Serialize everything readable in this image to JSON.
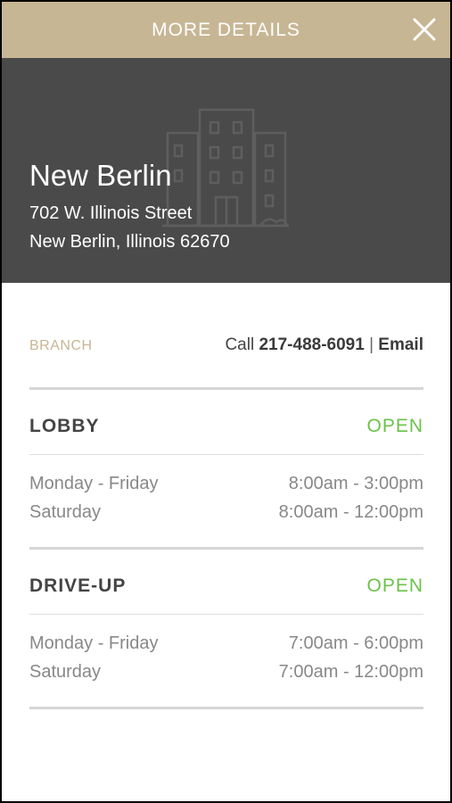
{
  "header": {
    "title": "MORE DETAILS",
    "close_icon": "close-icon"
  },
  "hero": {
    "branch_name": "New Berlin",
    "address_line1": "702 W. Illinois Street",
    "address_line2": "New Berlin, Illinois 62670",
    "illustration_icon": "building-icon",
    "background_color": "#4a4a4a"
  },
  "contact": {
    "label": "BRANCH",
    "call_prefix": "Call",
    "phone": "217-488-6091",
    "separator": "|",
    "email_label": "Email"
  },
  "sections": [
    {
      "title": "LOBBY",
      "status": "OPEN",
      "hours": [
        {
          "days": "Monday - Friday",
          "time": "8:00am - 3:00pm"
        },
        {
          "days": "Saturday",
          "time": "8:00am - 12:00pm"
        }
      ]
    },
    {
      "title": "DRIVE-UP",
      "status": "OPEN",
      "hours": [
        {
          "days": "Monday - Friday",
          "time": "7:00am - 6:00pm"
        },
        {
          "days": "Saturday",
          "time": "7:00am - 12:00pm"
        }
      ]
    }
  ],
  "colors": {
    "accent": "#c7b694",
    "open_status": "#6cc24a",
    "hero_bg": "#4a4a4a"
  }
}
